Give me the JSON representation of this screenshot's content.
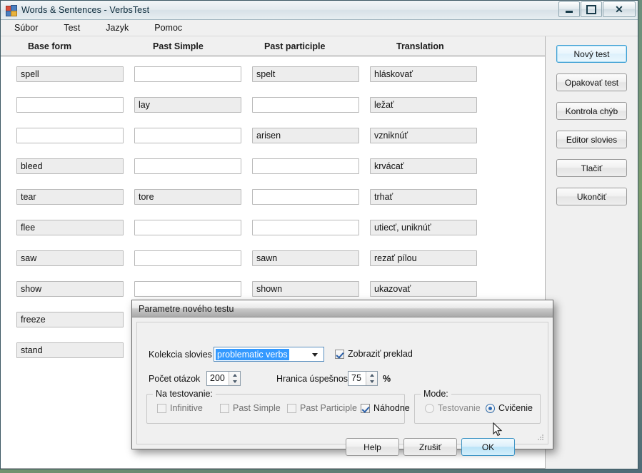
{
  "window": {
    "title": "Words & Sentences - VerbsTest",
    "icon": "app-windows-icon",
    "controls": {
      "minimize": "minimize-icon",
      "maximize": "maximize-icon",
      "close": "close-icon"
    }
  },
  "menubar": {
    "items": [
      {
        "label": "Súbor"
      },
      {
        "label": "Test"
      },
      {
        "label": "Jazyk"
      },
      {
        "label": "Pomoc"
      }
    ]
  },
  "grid": {
    "columns": [
      "Base form",
      "Past Simple",
      "Past participle",
      "Translation"
    ],
    "rows": [
      {
        "base": "spell",
        "past_simple": "",
        "past_participle": "spelt",
        "translation": "hláskovať"
      },
      {
        "base": "",
        "past_simple": "lay",
        "past_participle": "",
        "translation": "ležať"
      },
      {
        "base": "",
        "past_simple": "",
        "past_participle": "arisen",
        "translation": "vzniknúť"
      },
      {
        "base": "bleed",
        "past_simple": "",
        "past_participle": "",
        "translation": "krvácať"
      },
      {
        "base": "tear",
        "past_simple": "tore",
        "past_participle": "",
        "translation": "trhať"
      },
      {
        "base": "flee",
        "past_simple": "",
        "past_participle": "",
        "translation": "utiecť, uniknúť"
      },
      {
        "base": "saw",
        "past_simple": "",
        "past_participle": "sawn",
        "translation": "rezať pílou"
      },
      {
        "base": "show",
        "past_simple": "",
        "past_participle": "shown",
        "translation": "ukazovať"
      },
      {
        "base": "freeze",
        "past_simple": "",
        "past_participle": "",
        "translation": ""
      },
      {
        "base": "stand",
        "past_simple": "",
        "past_participle": "",
        "translation": ""
      }
    ]
  },
  "sidebar": {
    "buttons": [
      {
        "label": "Nový test",
        "focused": true
      },
      {
        "label": "Opakovať test",
        "focused": false
      },
      {
        "label": "Kontrola chýb",
        "focused": false
      },
      {
        "label": "Editor slovies",
        "focused": false
      },
      {
        "label": "Tlačiť",
        "focused": false
      },
      {
        "label": "Ukončiť",
        "focused": false
      }
    ]
  },
  "dialog": {
    "title": "Parametre nového testu",
    "collection_label": "Kolekcia  slovies",
    "collection_value": "problematic verbs",
    "show_translation_label": "Zobraziť preklad",
    "show_translation_checked": true,
    "question_count_label": "Počet otázok",
    "question_count_value": "200",
    "threshold_label": "Hranica úspešnosti",
    "threshold_value": "75",
    "percent_symbol": "%",
    "test_group_title": "Na testovanie:",
    "test_options": [
      {
        "label": "Infinitive",
        "checked": false,
        "disabled": true
      },
      {
        "label": "Past Simple",
        "checked": false,
        "disabled": true
      },
      {
        "label": "Past Participle",
        "checked": false,
        "disabled": true
      },
      {
        "label": "Náhodne",
        "checked": true,
        "disabled": false
      }
    ],
    "mode_group_title": "Mode:",
    "mode_options": [
      {
        "label": "Testovanie",
        "selected": false,
        "disabled": true
      },
      {
        "label": "Cvičenie",
        "selected": true,
        "disabled": false
      }
    ],
    "buttons": {
      "help": "Help",
      "cancel": "Zrušiť",
      "ok": "OK"
    }
  },
  "colors": {
    "accent_focus": "#3c9fd4",
    "selection_blue": "#3399ff",
    "window_chrome": "#f0f0f0",
    "desktop": "#6d8a7a"
  }
}
